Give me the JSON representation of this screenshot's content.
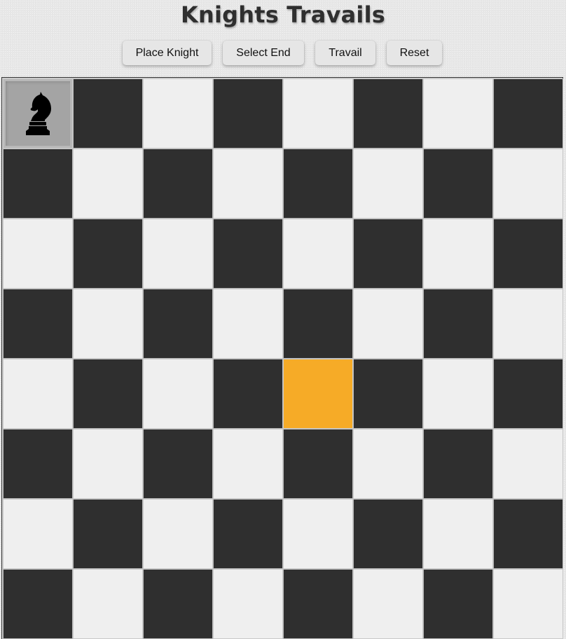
{
  "header": {
    "title": "Knights Travails"
  },
  "controls": {
    "place_knight": "Place Knight",
    "select_end": "Select End",
    "travail": "Travail",
    "reset": "Reset"
  },
  "board": {
    "size": 8,
    "colors": {
      "light": "#efefef",
      "dark": "#2f2f2f",
      "start_highlight": "#a4a4a4",
      "end_highlight": "#f6ab27"
    },
    "knight": {
      "icon": "knight-icon",
      "row": 0,
      "col": 0
    },
    "end_square": {
      "row": 4,
      "col": 4
    }
  }
}
